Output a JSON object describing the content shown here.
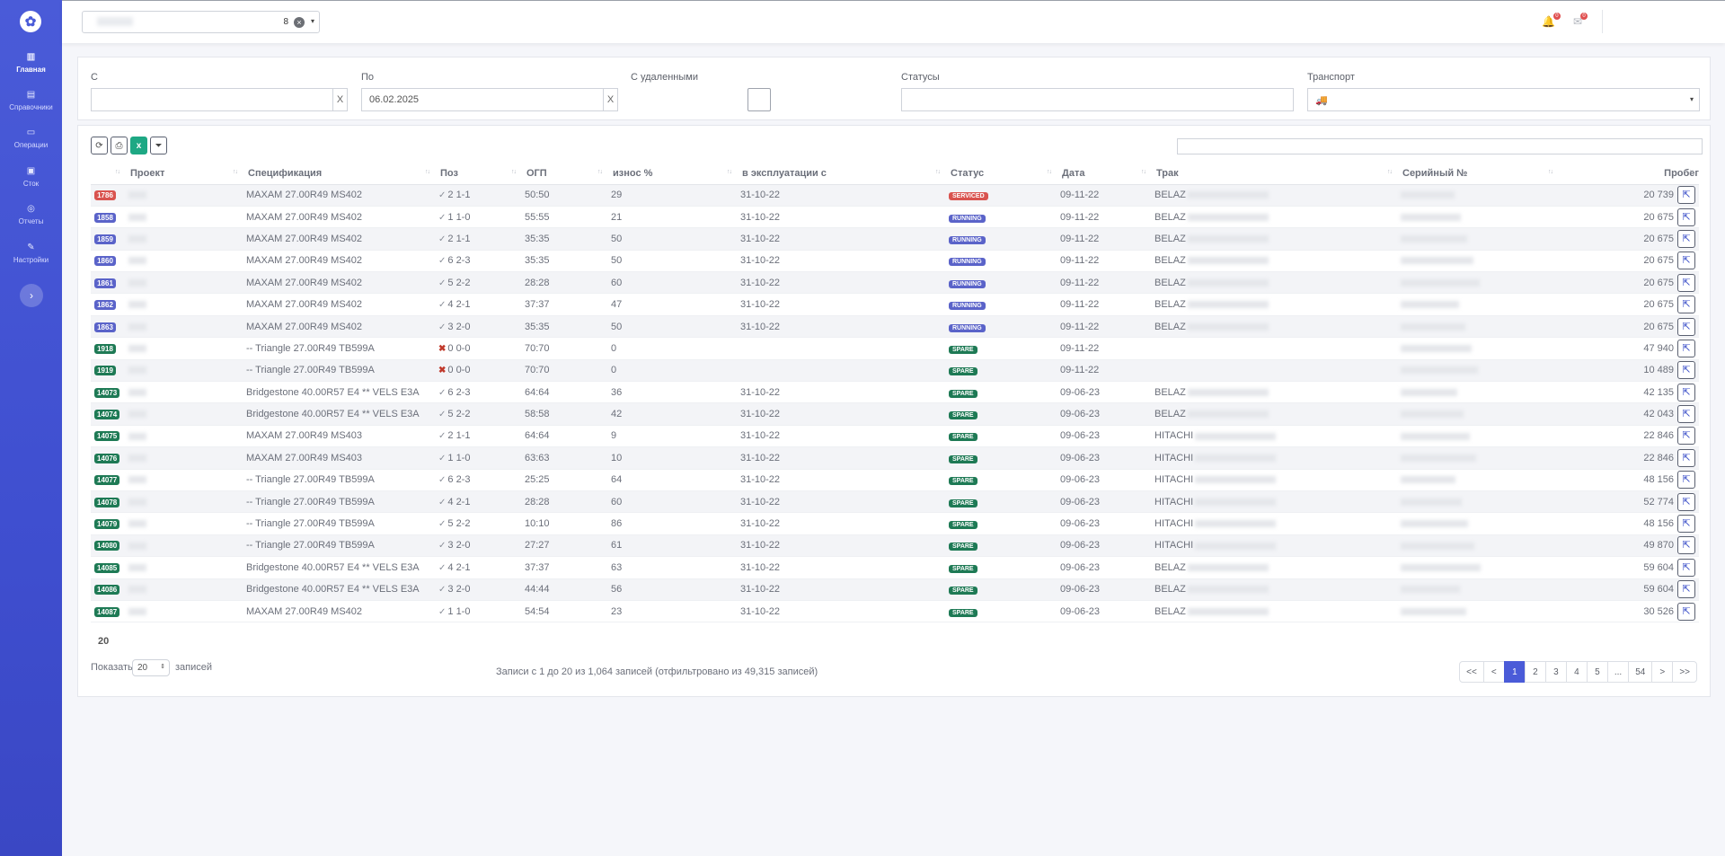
{
  "sidebar": {
    "logo_icon": "logo-icon",
    "items": [
      {
        "label": "Главная",
        "icon": "chart-icon",
        "active": true
      },
      {
        "label": "Справочники",
        "icon": "book-icon",
        "active": false
      },
      {
        "label": "Операции",
        "icon": "folder-icon",
        "active": false
      },
      {
        "label": "Сток",
        "icon": "box-icon",
        "active": false
      },
      {
        "label": "Отчеты",
        "icon": "report-icon",
        "active": false
      },
      {
        "label": "Настройки",
        "icon": "wrench-icon",
        "active": false
      }
    ],
    "toggle_icon": "chevron-right-icon"
  },
  "topbar": {
    "project_count": "8",
    "notifications": [
      {
        "icon": "bell-icon",
        "badge": "0"
      },
      {
        "icon": "mail-icon",
        "badge": "0"
      }
    ]
  },
  "filters": {
    "from_label": "С",
    "from_value": "",
    "to_label": "По",
    "to_value": "06.02.2025",
    "deleted_label": "С удаленными",
    "statuses_label": "Статусы",
    "transport_label": "Транспорт",
    "clear_label": "X"
  },
  "table": {
    "headers": [
      "Проект",
      "Спецификация",
      "Поз",
      "ОГП",
      "износ %",
      "в эксплуатации с",
      "Статус",
      "Дата",
      "Трак",
      "Серийный №",
      "Пробег"
    ],
    "status_colors": {
      "SERVICED": "#d9534f",
      "RUNNING": "#5a63c9",
      "SPARE": "#1e7a55"
    },
    "rows": [
      {
        "id": "1786",
        "spec": "MAXAM 27.00R49 MS402",
        "pos_ok": true,
        "pos": "2 1-1",
        "ogp": "50:50",
        "wear": "29",
        "since": "31-10-22",
        "status": "SERVICED",
        "date": "09-11-22",
        "truck": "BELAZ",
        "mileage": "20 739"
      },
      {
        "id": "1858",
        "spec": "MAXAM 27.00R49 MS402",
        "pos_ok": true,
        "pos": "1 1-0",
        "ogp": "55:55",
        "wear": "21",
        "since": "31-10-22",
        "status": "RUNNING",
        "date": "09-11-22",
        "truck": "BELAZ",
        "mileage": "20 675"
      },
      {
        "id": "1859",
        "spec": "MAXAM 27.00R49 MS402",
        "pos_ok": true,
        "pos": "2 1-1",
        "ogp": "35:35",
        "wear": "50",
        "since": "31-10-22",
        "status": "RUNNING",
        "date": "09-11-22",
        "truck": "BELAZ",
        "mileage": "20 675"
      },
      {
        "id": "1860",
        "spec": "MAXAM 27.00R49 MS402",
        "pos_ok": true,
        "pos": "6 2-3",
        "ogp": "35:35",
        "wear": "50",
        "since": "31-10-22",
        "status": "RUNNING",
        "date": "09-11-22",
        "truck": "BELAZ",
        "mileage": "20 675"
      },
      {
        "id": "1861",
        "spec": "MAXAM 27.00R49 MS402",
        "pos_ok": true,
        "pos": "5 2-2",
        "ogp": "28:28",
        "wear": "60",
        "since": "31-10-22",
        "status": "RUNNING",
        "date": "09-11-22",
        "truck": "BELAZ",
        "mileage": "20 675"
      },
      {
        "id": "1862",
        "spec": "MAXAM 27.00R49 MS402",
        "pos_ok": true,
        "pos": "4 2-1",
        "ogp": "37:37",
        "wear": "47",
        "since": "31-10-22",
        "status": "RUNNING",
        "date": "09-11-22",
        "truck": "BELAZ",
        "mileage": "20 675"
      },
      {
        "id": "1863",
        "spec": "MAXAM 27.00R49 MS402",
        "pos_ok": true,
        "pos": "3 2-0",
        "ogp": "35:35",
        "wear": "50",
        "since": "31-10-22",
        "status": "RUNNING",
        "date": "09-11-22",
        "truck": "BELAZ",
        "mileage": "20 675"
      },
      {
        "id": "1918",
        "spec": "-- Triangle 27.00R49 TB599A",
        "pos_ok": false,
        "pos": "0 0-0",
        "ogp": "70:70",
        "wear": "0",
        "since": "",
        "status": "SPARE",
        "date": "09-11-22",
        "truck": "",
        "mileage": "47 940"
      },
      {
        "id": "1919",
        "spec": "-- Triangle 27.00R49 TB599A",
        "pos_ok": false,
        "pos": "0 0-0",
        "ogp": "70:70",
        "wear": "0",
        "since": "",
        "status": "SPARE",
        "date": "09-11-22",
        "truck": "",
        "mileage": "10 489"
      },
      {
        "id": "14073",
        "spec": "Bridgestone 40.00R57 E4 ** VELS E3A",
        "pos_ok": true,
        "pos": "6 2-3",
        "ogp": "64:64",
        "wear": "36",
        "since": "31-10-22",
        "status": "SPARE",
        "date": "09-06-23",
        "truck": "BELAZ",
        "mileage": "42 135"
      },
      {
        "id": "14074",
        "spec": "Bridgestone 40.00R57 E4 ** VELS E3A",
        "pos_ok": true,
        "pos": "5 2-2",
        "ogp": "58:58",
        "wear": "42",
        "since": "31-10-22",
        "status": "SPARE",
        "date": "09-06-23",
        "truck": "BELAZ",
        "mileage": "42 043"
      },
      {
        "id": "14075",
        "spec": "MAXAM 27.00R49 MS403",
        "pos_ok": true,
        "pos": "2 1-1",
        "ogp": "64:64",
        "wear": "9",
        "since": "31-10-22",
        "status": "SPARE",
        "date": "09-06-23",
        "truck": "HITACHI",
        "mileage": "22 846"
      },
      {
        "id": "14076",
        "spec": "MAXAM 27.00R49 MS403",
        "pos_ok": true,
        "pos": "1 1-0",
        "ogp": "63:63",
        "wear": "10",
        "since": "31-10-22",
        "status": "SPARE",
        "date": "09-06-23",
        "truck": "HITACHI",
        "mileage": "22 846"
      },
      {
        "id": "14077",
        "spec": "-- Triangle 27.00R49 TB599A",
        "pos_ok": true,
        "pos": "6 2-3",
        "ogp": "25:25",
        "wear": "64",
        "since": "31-10-22",
        "status": "SPARE",
        "date": "09-06-23",
        "truck": "HITACHI",
        "mileage": "48 156"
      },
      {
        "id": "14078",
        "spec": "-- Triangle 27.00R49 TB599A",
        "pos_ok": true,
        "pos": "4 2-1",
        "ogp": "28:28",
        "wear": "60",
        "since": "31-10-22",
        "status": "SPARE",
        "date": "09-06-23",
        "truck": "HITACHI",
        "mileage": "52 774"
      },
      {
        "id": "14079",
        "spec": "-- Triangle 27.00R49 TB599A",
        "pos_ok": true,
        "pos": "5 2-2",
        "ogp": "10:10",
        "wear": "86",
        "since": "31-10-22",
        "status": "SPARE",
        "date": "09-06-23",
        "truck": "HITACHI",
        "mileage": "48 156"
      },
      {
        "id": "14080",
        "spec": "-- Triangle 27.00R49 TB599A",
        "pos_ok": true,
        "pos": "3 2-0",
        "ogp": "27:27",
        "wear": "61",
        "since": "31-10-22",
        "status": "SPARE",
        "date": "09-06-23",
        "truck": "HITACHI",
        "mileage": "49 870"
      },
      {
        "id": "14085",
        "spec": "Bridgestone 40.00R57 E4 ** VELS E3A",
        "pos_ok": true,
        "pos": "4 2-1",
        "ogp": "37:37",
        "wear": "63",
        "since": "31-10-22",
        "status": "SPARE",
        "date": "09-06-23",
        "truck": "BELAZ",
        "mileage": "59 604"
      },
      {
        "id": "14086",
        "spec": "Bridgestone 40.00R57 E4 ** VELS E3A",
        "pos_ok": true,
        "pos": "3 2-0",
        "ogp": "44:44",
        "wear": "56",
        "since": "31-10-22",
        "status": "SPARE",
        "date": "09-06-23",
        "truck": "BELAZ",
        "mileage": "59 604"
      },
      {
        "id": "14087",
        "spec": "MAXAM 27.00R49 MS402",
        "pos_ok": true,
        "pos": "1 1-0",
        "ogp": "54:54",
        "wear": "23",
        "since": "31-10-22",
        "status": "SPARE",
        "date": "09-06-23",
        "truck": "BELAZ",
        "mileage": "30 526"
      }
    ]
  },
  "footer": {
    "count": "20",
    "show_label": "Показать",
    "page_size": "20",
    "records_label": "записей",
    "info": "Записи с 1 до 20 из 1,064 записей (отфильтровано из 49,315 записей)",
    "pages": [
      "<<",
      "<",
      "1",
      "2",
      "3",
      "4",
      "5",
      "...",
      "54",
      ">",
      ">>"
    ],
    "active_page": "1"
  }
}
